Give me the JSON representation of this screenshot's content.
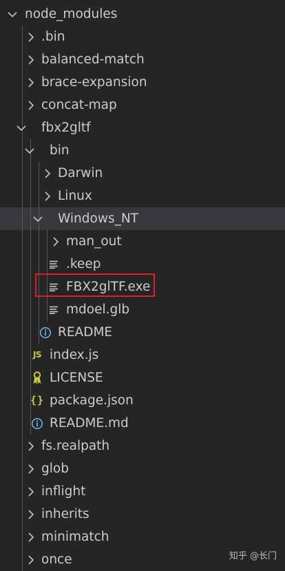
{
  "explorer": {
    "items": [
      {
        "label": "node_modules",
        "depth": 0,
        "kind": "folder",
        "expanded": true,
        "icon": "chevron-down-icon",
        "name": "folder-node-modules"
      },
      {
        "label": ".bin",
        "depth": 1,
        "kind": "folder",
        "expanded": false,
        "icon": "chevron-right-icon",
        "name": "folder-bin-hidden"
      },
      {
        "label": "balanced-match",
        "depth": 1,
        "kind": "folder",
        "expanded": false,
        "icon": "chevron-right-icon",
        "name": "folder-balanced-match"
      },
      {
        "label": "brace-expansion",
        "depth": 1,
        "kind": "folder",
        "expanded": false,
        "icon": "chevron-right-icon",
        "name": "folder-brace-expansion"
      },
      {
        "label": "concat-map",
        "depth": 1,
        "kind": "folder",
        "expanded": false,
        "icon": "chevron-right-icon",
        "name": "folder-concat-map"
      },
      {
        "label": "fbx2gltf",
        "depth": 1,
        "kind": "folder",
        "expanded": true,
        "icon": "chevron-down-icon",
        "name": "folder-fbx2gltf"
      },
      {
        "label": "bin",
        "depth": 2,
        "kind": "folder",
        "expanded": true,
        "icon": "chevron-down-icon",
        "name": "folder-bin"
      },
      {
        "label": "Darwin",
        "depth": 3,
        "kind": "folder",
        "expanded": false,
        "icon": "chevron-right-icon",
        "name": "folder-darwin"
      },
      {
        "label": "Linux",
        "depth": 3,
        "kind": "folder",
        "expanded": false,
        "icon": "chevron-right-icon",
        "name": "folder-linux"
      },
      {
        "label": "Windows_NT",
        "depth": 3,
        "kind": "folder",
        "expanded": true,
        "icon": "chevron-down-icon",
        "name": "folder-windows-nt",
        "selected": true
      },
      {
        "label": "man_out",
        "depth": 4,
        "kind": "folder",
        "expanded": false,
        "icon": "chevron-right-icon",
        "name": "folder-man-out"
      },
      {
        "label": ".keep",
        "depth": 4,
        "kind": "file",
        "icon": "text-file-icon",
        "name": "file-keep"
      },
      {
        "label": "FBX2glTF.exe",
        "depth": 4,
        "kind": "file",
        "icon": "text-file-icon",
        "name": "file-fbx2gltf-exe"
      },
      {
        "label": "mdoel.glb",
        "depth": 4,
        "kind": "file",
        "icon": "text-file-icon",
        "name": "file-mdoel-glb"
      },
      {
        "label": "README",
        "depth": 3,
        "kind": "file",
        "icon": "info-icon",
        "name": "file-readme"
      },
      {
        "label": "index.js",
        "depth": 2,
        "kind": "file",
        "icon": "js-file-icon",
        "name": "file-index-js"
      },
      {
        "label": "LICENSE",
        "depth": 2,
        "kind": "file",
        "icon": "license-icon",
        "name": "file-license"
      },
      {
        "label": "package.json",
        "depth": 2,
        "kind": "file",
        "icon": "json-file-icon",
        "name": "file-package-json"
      },
      {
        "label": "README.md",
        "depth": 2,
        "kind": "file",
        "icon": "info-icon",
        "name": "file-readme-md"
      },
      {
        "label": "fs.realpath",
        "depth": 1,
        "kind": "folder",
        "expanded": false,
        "icon": "chevron-right-icon",
        "name": "folder-fs-realpath"
      },
      {
        "label": "glob",
        "depth": 1,
        "kind": "folder",
        "expanded": false,
        "icon": "chevron-right-icon",
        "name": "folder-glob"
      },
      {
        "label": "inflight",
        "depth": 1,
        "kind": "folder",
        "expanded": false,
        "icon": "chevron-right-icon",
        "name": "folder-inflight"
      },
      {
        "label": "inherits",
        "depth": 1,
        "kind": "folder",
        "expanded": false,
        "icon": "chevron-right-icon",
        "name": "folder-inherits"
      },
      {
        "label": "minimatch",
        "depth": 1,
        "kind": "folder",
        "expanded": false,
        "icon": "chevron-right-icon",
        "name": "folder-minimatch"
      },
      {
        "label": "once",
        "depth": 1,
        "kind": "folder",
        "expanded": false,
        "icon": "chevron-right-icon",
        "name": "folder-once"
      }
    ]
  },
  "highlight": {
    "target": "FBX2glTF.exe",
    "color": "#d9202e"
  },
  "watermark": "知乎 @长门",
  "colors": {
    "background": "#252526",
    "text": "#cccccc",
    "selected_row": "#37373d",
    "indent_guide": "#585858",
    "info_icon": "#75beff",
    "js_icon": "#cbcb41",
    "license_icon": "#cbcb41"
  }
}
